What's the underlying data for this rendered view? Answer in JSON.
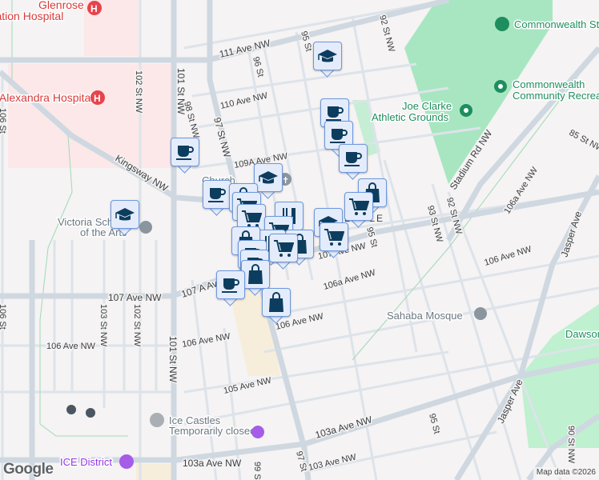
{
  "map": {
    "streets": {
      "ave111": "111 Ave NW",
      "ave110": "110 Ave NW",
      "ave109a": "109A Ave NW",
      "kingsway": "Kingsway NW",
      "ave107a": "107 A Ave NW",
      "ave107": "107 Ave NW",
      "ave107_east": "107 Ave NW",
      "ave106a": "106a Ave NW",
      "ave106_west": "106 Ave NW",
      "ave106_mid": "106 Ave NW",
      "ave106_center": "106 Ave NW",
      "ave106_east": "106 Ave NW",
      "ave106a_east": "106a Ave NW",
      "ave105": "105 Ave NW",
      "ave103a_west": "103a Ave NW",
      "ave103a_east": "103a Ave NW",
      "ave103": "103 Ave NW",
      "st106_top": "106 St",
      "st106_bottom": "106 St",
      "st103": "103 St NW",
      "st102_top": "102 St NW",
      "st102_bottom": "102 St NW",
      "st101_top": "101 St NW",
      "st101_bottom": "101 St NW",
      "st98": "98 St NW",
      "st97": "97 St NW",
      "st97_bottom": "97 St",
      "st96": "96 St",
      "st95_top": "95 St",
      "st95_mid": "95 St",
      "st95_right": "95 St",
      "st95_bottom": "95 St",
      "st93": "93 St NW",
      "st92_top": "92 St NW",
      "st92": "92 St NW",
      "st99": "99 St",
      "st90": "90 St NW",
      "st85": "85 St NW",
      "stadium": "Stadium Rd NW",
      "jasper_top": "Jasper Ave",
      "jasper_bottom": "Jasper Ave",
      "boyle": "BOYLE"
    },
    "pois": {
      "glenrose": "Glenrose Rehabilitation Hospital",
      "glenrose_line1": "Glenrose",
      "glenrose_line2": "Rehabilitation Hospital",
      "alexandra": "Royal Alexandra Hospital",
      "commonwealth_stadium": "Commonwealth Stadium",
      "commonwealth_rec_line1": "Commonwealth",
      "commonwealth_rec_line2": "Community Recreation Centre",
      "joe_clarke_line1": "Joe Clarke",
      "joe_clarke_line2": "Athletic Grounds",
      "victoria_line1": "Victoria School",
      "victoria_line2": "of the Arts",
      "church": "Church",
      "sahaba": "Sahaba Mosque",
      "dawson": "Dawson Park",
      "ice_castles": "Ice Castles",
      "ice_castles_status": "Temporarily closed",
      "ice_district": "ICE District"
    },
    "markers": [
      {
        "type": "coffee-icon"
      },
      {
        "type": "graduation-cap-icon"
      },
      {
        "type": "coffee-icon"
      },
      {
        "type": "coffee-icon"
      },
      {
        "type": "coffee-icon"
      },
      {
        "type": "shopping-bag-icon"
      },
      {
        "type": "shopping-cart-icon"
      },
      {
        "type": "graduation-cap-icon"
      },
      {
        "type": "shopping-cart-icon"
      },
      {
        "type": "graduation-cap-icon"
      },
      {
        "type": "graduation-cap-icon"
      },
      {
        "type": "coffee-icon"
      },
      {
        "type": "shopping-bag-icon"
      },
      {
        "type": "shopping-cart-icon"
      },
      {
        "type": "shopping-cart-icon"
      },
      {
        "type": "restaurant-icon"
      },
      {
        "type": "shopping-cart-icon"
      },
      {
        "type": "shopping-bag-icon"
      },
      {
        "type": "restaurant-icon"
      },
      {
        "type": "shopping-cart-icon"
      },
      {
        "type": "shopping-bag-icon"
      },
      {
        "type": "coffee-icon"
      },
      {
        "type": "coffee-icon"
      },
      {
        "type": "shopping-bag-icon"
      },
      {
        "type": "shopping-bag-icon"
      },
      {
        "type": "coffee-icon"
      }
    ],
    "logo": "Google",
    "attribution": "Map data ©2026"
  }
}
